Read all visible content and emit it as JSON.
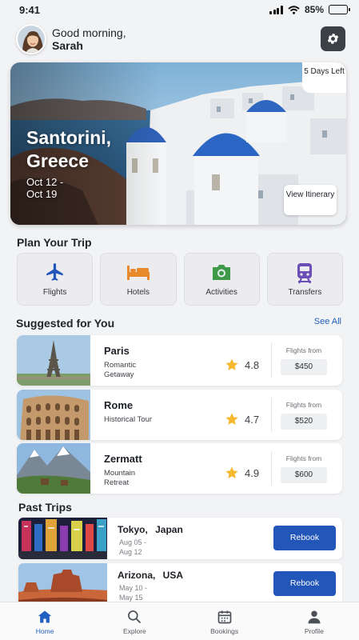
{
  "status": {
    "time": "9:41",
    "battery": "85%",
    "battery_level": 0.85
  },
  "header": {
    "greeting": "Good morning,",
    "name": "Sarah"
  },
  "hero": {
    "destination": "Santorini, Greece",
    "dates": "Oct 12 - Oct 19",
    "days_left": "5 Days Left",
    "itinerary_button": "View Itinerary"
  },
  "plan": {
    "title": "Plan Your Trip",
    "items": [
      {
        "label": "Flights",
        "icon": "airplane-icon",
        "color": "#2356b9"
      },
      {
        "label": "Hotels",
        "icon": "bed-icon",
        "color": "#e8892b"
      },
      {
        "label": "Activities",
        "icon": "camera-icon",
        "color": "#3e9a48"
      },
      {
        "label": "Transfers",
        "icon": "train-icon",
        "color": "#6b4fb7"
      }
    ]
  },
  "suggested": {
    "title": "Suggested for You",
    "see_all": "See All",
    "items": [
      {
        "city": "Paris",
        "desc": "Romantic Getaway",
        "rating": "4.8",
        "flights_from": "Flights from",
        "price": "$450"
      },
      {
        "city": "Rome",
        "desc": "Historical Tour",
        "rating": "4.7",
        "flights_from": "Flights from",
        "price": "$520"
      },
      {
        "city": "Zermatt",
        "desc": "Mountain Retreat",
        "rating": "4.9",
        "flights_from": "Flights from",
        "price": "$600"
      }
    ]
  },
  "past": {
    "title": "Past Trips",
    "items": [
      {
        "place": "Tokyo, Japan",
        "dates": "Aug 05 - Aug 12",
        "button": "Rebook"
      },
      {
        "place": "Arizona, USA",
        "dates": "May 10 - May 15",
        "button": "Rebook"
      }
    ]
  },
  "tabs": [
    {
      "label": "Home",
      "icon": "home-icon",
      "active": true
    },
    {
      "label": "Explore",
      "icon": "search-icon",
      "active": false
    },
    {
      "label": "Bookings",
      "icon": "calendar-icon",
      "active": false
    },
    {
      "label": "Profile",
      "icon": "person-icon",
      "active": false
    }
  ],
  "colors": {
    "accent": "#2356b9",
    "star": "#f5b82e"
  }
}
